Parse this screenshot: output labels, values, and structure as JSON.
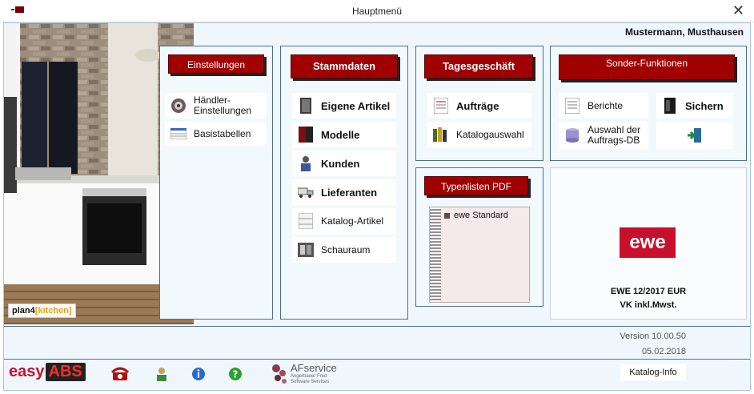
{
  "window": {
    "title": "Hauptmenü",
    "close_glyph": "✕"
  },
  "user": "Mustermann, Musthausen",
  "photo": {
    "brand_left": "plan4",
    "brand_right": "[kitchen]"
  },
  "einstellungen": {
    "header": "Einstellungen",
    "items": [
      {
        "label": "Händler-\nEinstellungen",
        "icon": "gear-disc-icon"
      },
      {
        "label": "Basistabellen",
        "icon": "table-icon"
      }
    ]
  },
  "stammdaten": {
    "header": "Stammdaten",
    "items": [
      {
        "label": "Eigene Artikel",
        "bold": true,
        "icon": "cabinet-icon"
      },
      {
        "label": "Modelle",
        "bold": true,
        "icon": "wardrobe-icon"
      },
      {
        "label": "Kunden",
        "bold": true,
        "icon": "customer-icon"
      },
      {
        "label": "Lieferanten",
        "bold": true,
        "icon": "truck-icon"
      },
      {
        "label": "Katalog-Artikel",
        "bold": false,
        "icon": "shelf-icon"
      },
      {
        "label": "Schauraum",
        "bold": false,
        "icon": "showroom-icon"
      }
    ]
  },
  "tagesgeschaeft": {
    "header": "Tagesgeschäft",
    "items": [
      {
        "label": "Aufträge",
        "bold": true,
        "icon": "orders-icon"
      },
      {
        "label": "Katalogauswahl",
        "bold": false,
        "icon": "catalog-icon"
      }
    ]
  },
  "sonder": {
    "header": "Sonder-Funktionen",
    "items": [
      {
        "label": "Berichte",
        "icon": "report-icon"
      },
      {
        "label": "Sichern",
        "bold": true,
        "icon": "binder-icon"
      },
      {
        "label": "Auswahl der\nAuftrags-DB",
        "icon": "database-icon"
      },
      {
        "label": "",
        "icon": "exit-door-icon"
      }
    ]
  },
  "typenlisten": {
    "header": "Typenlisten PDF",
    "items": [
      "ewe Standard"
    ]
  },
  "catalog": {
    "brand": "ewe",
    "line1": "EWE 12/2017 EUR",
    "line2": "VK inkl.Mwst."
  },
  "version": "Version 10.00.50",
  "date": "05.02.2018",
  "footer": {
    "brand_easy": "easy",
    "brand_abs": "ABS",
    "afservice": "AFservice",
    "afservice_sub1": "Angerbauer Fred",
    "afservice_sub2": "Software Services",
    "katalog_info": "Katalog-Info"
  },
  "colors": {
    "header_red": "#a00000",
    "panel_border": "#4d6f8a",
    "client_bg": "#f0f7fc",
    "ewe_red": "#c8102e"
  }
}
